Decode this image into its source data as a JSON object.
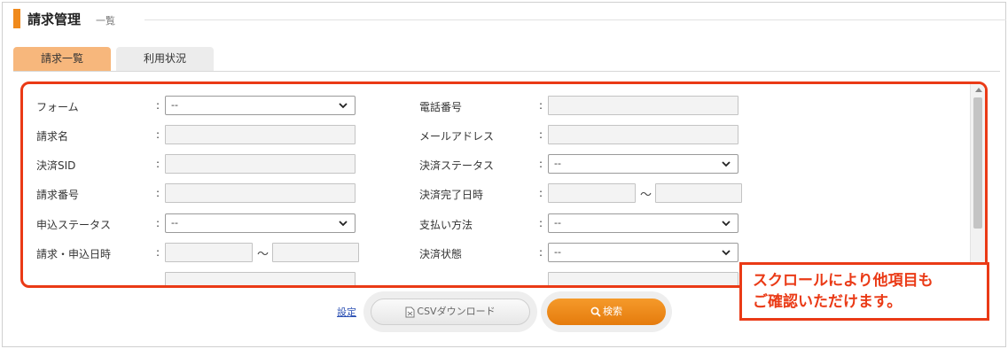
{
  "header": {
    "title": "請求管理",
    "subtitle": "一覧"
  },
  "tabs": [
    {
      "label": "請求一覧",
      "active": true
    },
    {
      "label": "利用状況",
      "active": false
    }
  ],
  "form": {
    "colon": ":",
    "range_separator": "～",
    "left": [
      {
        "label": "フォーム",
        "type": "select",
        "value": "--"
      },
      {
        "label": "請求名",
        "type": "text",
        "value": ""
      },
      {
        "label": "決済SID",
        "type": "text",
        "value": ""
      },
      {
        "label": "請求番号",
        "type": "text",
        "value": ""
      },
      {
        "label": "申込ステータス",
        "type": "select",
        "value": "--"
      },
      {
        "label": "請求・申込日時",
        "type": "range",
        "from": "",
        "to": ""
      }
    ],
    "right": [
      {
        "label": "電話番号",
        "type": "text",
        "value": ""
      },
      {
        "label": "メールアドレス",
        "type": "text",
        "value": ""
      },
      {
        "label": "決済ステータス",
        "type": "select",
        "value": "--"
      },
      {
        "label": "決済完了日時",
        "type": "range",
        "from": "",
        "to": ""
      },
      {
        "label": "支払い方法",
        "type": "select",
        "value": "--"
      },
      {
        "label": "決済状態",
        "type": "select",
        "value": "--"
      }
    ]
  },
  "actions": {
    "settings_label": "設定",
    "csv_label": "CSVダウンロード",
    "search_label": "検索"
  },
  "callout": {
    "line1": "スクロールにより他項目も",
    "line2": "ご確認いただけます。"
  },
  "colors": {
    "accent": "#f08a1c",
    "tab_active": "#f7b77c",
    "highlight_red": "#ea3a16",
    "search_button": "#e57b0d",
    "link": "#2a4fb3"
  },
  "icons": {
    "csv": "file-csv-icon",
    "search": "magnifier-icon",
    "select": "chevron-down-icon"
  }
}
